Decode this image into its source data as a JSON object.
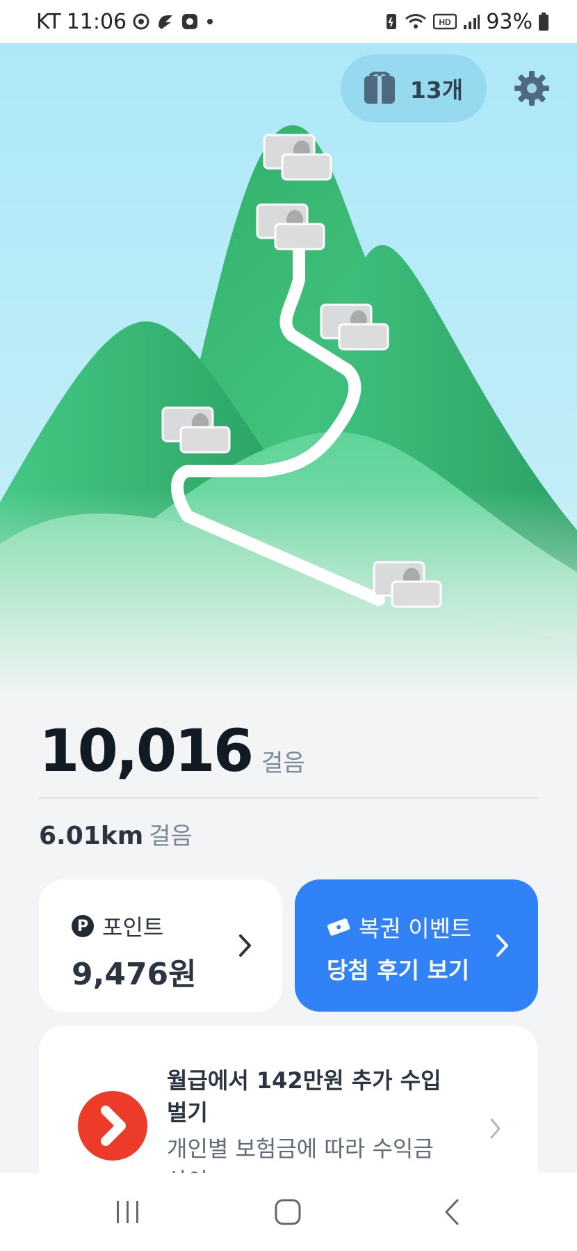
{
  "status_bar": {
    "carrier": "KT",
    "time": "11:06",
    "battery": "93%"
  },
  "header": {
    "ticket_count": "13개"
  },
  "steps": {
    "value": "10,016",
    "unit": "걸음"
  },
  "distance": {
    "value": "6.01km",
    "unit": "걸음"
  },
  "points_card": {
    "badge": "P",
    "label": "포인트",
    "value": "9,476원"
  },
  "lottery_card": {
    "title": "복권 이벤트",
    "subtitle": "당첨 후기 보기"
  },
  "ad_card": {
    "title": "월급에서 142만원 추가 수입벌기",
    "description": "개인별 보험금에 따라 수익금 상이"
  },
  "colors": {
    "accent_blue": "#3182f6",
    "ad_logo_red": "#ec3b29",
    "sky": "#b3e9f7",
    "mountain_green": "#3fbf7f"
  }
}
